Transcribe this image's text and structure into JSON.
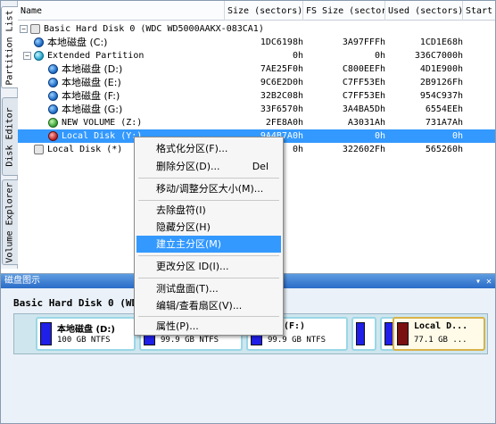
{
  "tabs": [
    "Partition List",
    "Disk Editor",
    "Volume Explorer"
  ],
  "columns": {
    "name": "Name",
    "size": "Size (sectors)",
    "fs": "FS Size (sectors)",
    "used": "Used (sectors)",
    "start": "Start"
  },
  "rows": [
    {
      "name": "Basic Hard Disk 0 (WDC WD5000AAKX-083CA1)",
      "size": "",
      "fs": "",
      "used": "",
      "icon": "hard-disk-icon"
    },
    {
      "name": "本地磁盘 (C:)",
      "size": "1DC6198h",
      "fs": "3A97FFFh",
      "used": "1CD1E68h",
      "icon": "partition-blue-icon"
    },
    {
      "name": "Extended Partition",
      "size": "0h",
      "fs": "0h",
      "used": "336C7000h",
      "icon": "partition-cyan-icon"
    },
    {
      "name": "本地磁盘 (D:)",
      "size": "7AE25F0h",
      "fs": "C800EEFh",
      "used": "4D1E900h",
      "icon": "partition-blue-icon"
    },
    {
      "name": "本地磁盘 (E:)",
      "size": "9C6E2D0h",
      "fs": "C7FF53Eh",
      "used": "2B9126Fh",
      "icon": "partition-blue-icon"
    },
    {
      "name": "本地磁盘 (F:)",
      "size": "32B2C08h",
      "fs": "C7FF53Eh",
      "used": "954C937h",
      "icon": "partition-blue-icon"
    },
    {
      "name": "本地磁盘 (G:)",
      "size": "33F6570h",
      "fs": "3A4BA5Dh",
      "used": "6554EEh",
      "icon": "partition-blue-icon"
    },
    {
      "name": "NEW VOLUME (Z:)",
      "size": "2FE8A0h",
      "fs": "A3031Ah",
      "used": "731A7Ah",
      "icon": "partition-green-icon"
    },
    {
      "name": "Local Disk (Y:)",
      "size": "9A4B7A0h",
      "fs": "0h",
      "used": "0h",
      "icon": "partition-red-icon"
    },
    {
      "name": "Local Disk (*)",
      "size": "0h",
      "fs": "322602Fh",
      "used": "565260h",
      "icon": "partition-gray-icon"
    }
  ],
  "bottom": {
    "title": "磁盘图示",
    "disk_name": "Basic Hard Disk 0 (WDC",
    "partitions": [
      {
        "name": "本地磁盘 (D:)",
        "info": "100 GB NTFS"
      },
      {
        "name": "",
        "info": "99.9 GB NTFS"
      },
      {
        "name": "(F:)",
        "info": "99.9 GB NTFS"
      },
      {
        "name": "",
        "info": ""
      },
      {
        "name": "Local D...",
        "info": "77.1 GB ..."
      }
    ]
  },
  "menu": {
    "format": "格式化分区(F)...",
    "delete": "删除分区(D)...",
    "delete_shortcut": "Del",
    "resize": "移动/调整分区大小(M)...",
    "remove_letter": "去除盘符(I)",
    "hide": "隐藏分区(H)",
    "set_primary": "建立主分区(M)",
    "change_id": "更改分区 ID(I)...",
    "surface_test": "测试盘面(T)...",
    "edit_sectors": "编辑/查看扇区(V)...",
    "properties": "属性(P)..."
  },
  "colors": {
    "selection": "#3399ff",
    "panel_title": "#2a6cc8",
    "partition_bar": "#1f1fe8"
  }
}
